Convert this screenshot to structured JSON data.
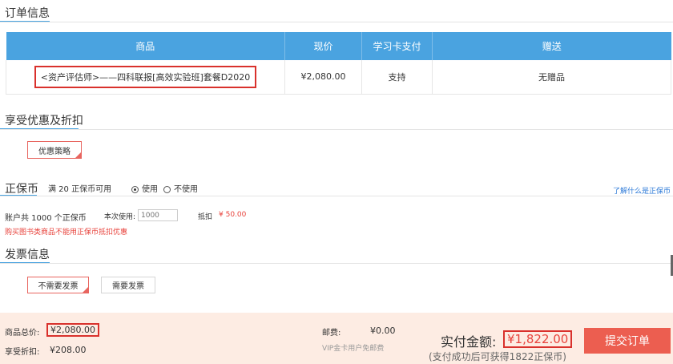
{
  "order": {
    "title": "订单信息",
    "headers": [
      "商品",
      "现价",
      "学习卡支付",
      "赠送"
    ],
    "row": {
      "product": "<资产评估师>——四科联报[高效实验班]套餐D2020",
      "price": "¥2,080.00",
      "card_pay": "支持",
      "gift": "无赠品"
    }
  },
  "discount": {
    "title": "享受优惠及折扣",
    "button": "优惠策略"
  },
  "coin": {
    "title": "正保币",
    "rule": "满 20 正保币可用",
    "use_label": "使用",
    "nouse_label": "不使用",
    "help_link": "了解什么是正保币",
    "balance": "账户共 1000 个正保币",
    "this_use_label": "本次使用:",
    "input_placeholder": "1000",
    "deduct_label": "抵扣",
    "deduct_value": "¥ 50.00",
    "warning": "购买图书类商品不能用正保币抵扣优惠"
  },
  "invoice": {
    "title": "发票信息",
    "opt_none": "不需要发票",
    "opt_need": "需要发票"
  },
  "footer": {
    "total_label": "商品总价:",
    "total_value": "¥2,080.00",
    "discount_label": "享受折扣:",
    "discount_value": "¥208.00",
    "shipping_label": "邮费:",
    "shipping_value": "¥0.00",
    "vip_note": "VIP金卡用户免邮费",
    "pay_label": "实付金额:",
    "pay_value": "¥1,822.00",
    "pay_note": "(支付成功后可获得1822正保币)",
    "submit": "提交订单"
  },
  "colors": {
    "accent_blue": "#4aa3e0",
    "highlight_red": "#d9312c",
    "submit_bg": "#ec5e50",
    "footer_bg": "#fdece3"
  }
}
